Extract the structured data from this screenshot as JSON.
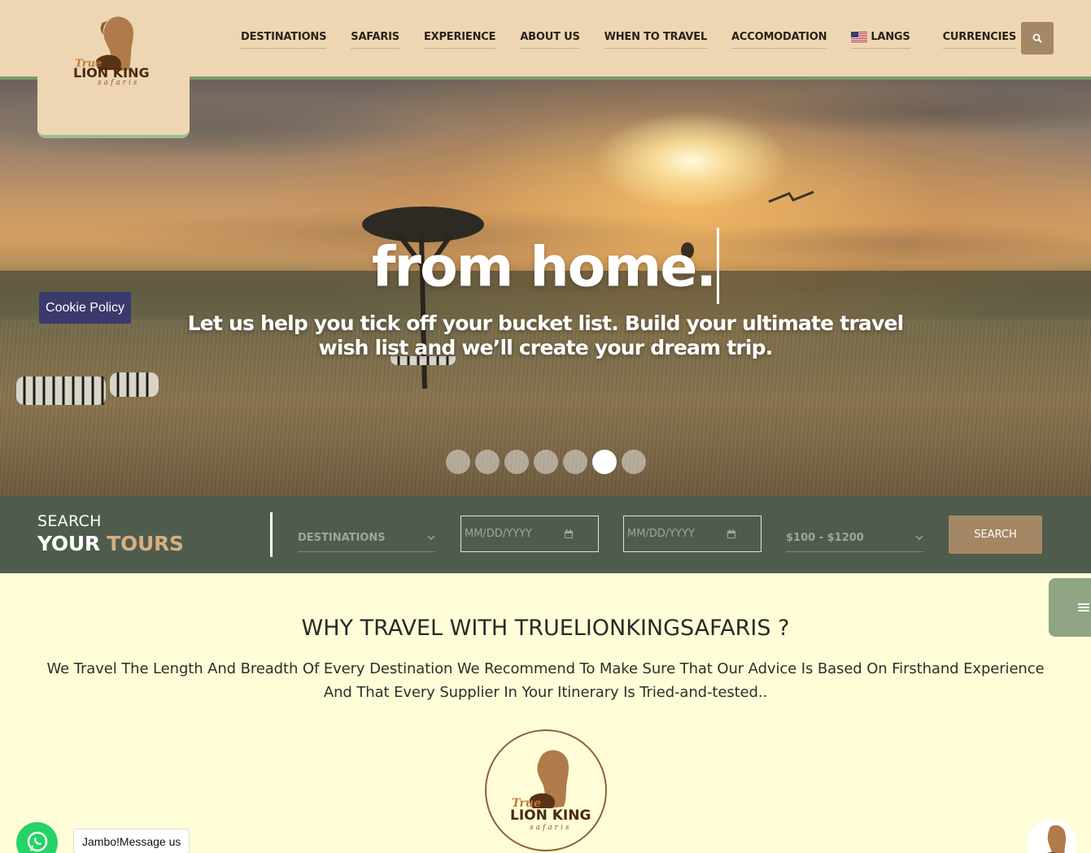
{
  "brand": {
    "logo_top": "True",
    "logo_main": "LION KING",
    "logo_sub": "safaris",
    "colors": {
      "header_bg": "#eed6b2",
      "accent_green": "#7d9a6d",
      "brand_brown": "#a48764",
      "searchbar_bg": "#4f5c4d",
      "page_bg": "#fffdd8",
      "cookie_bg": "#3a3a6c"
    }
  },
  "nav": {
    "items": [
      {
        "label": "DESTINATIONS"
      },
      {
        "label": "SAFARIS"
      },
      {
        "label": "EXPERIENCE"
      },
      {
        "label": "ABOUT US"
      },
      {
        "label": "WHEN TO TRAVEL"
      },
      {
        "label": "ACCOMODATION"
      },
      {
        "label": "LANGS",
        "icon": "us-flag-icon"
      },
      {
        "label": "CURRENCIES"
      }
    ],
    "search_icon": "search-icon"
  },
  "hero": {
    "title": "from home.",
    "subtitle": "Let us help you tick off your bucket list. Build your ultimate travel wish list and we’ll create your dream trip.",
    "slides_total": 7,
    "active_slide": 6
  },
  "cookie": {
    "label": "Cookie Policy"
  },
  "search": {
    "title_line1": "SEARCH",
    "title_word1": "YOUR",
    "title_word2": "TOURS",
    "destinations_placeholder": "DESTINATIONS",
    "date_from_placeholder": "MM/DD/YYYY",
    "date_to_placeholder": "MM/DD/YYYY",
    "price_range": "$100 - $1200",
    "button_label": "SEARCH"
  },
  "why": {
    "title": "WHY TRAVEL WITH TRUELIONKINGSAFARIS ?",
    "text": "We Travel The Length And Breadth Of Every Destination We Recommend To Make Sure That Our Advice Is Based On Firsthand Experience And That Every Supplier In Your Itinerary Is Tried-and-tested.."
  },
  "chat": {
    "bubble": "Jambo!Message us",
    "icon": "whatsapp-icon"
  },
  "side_tab": {
    "icon": "menu-icon"
  }
}
